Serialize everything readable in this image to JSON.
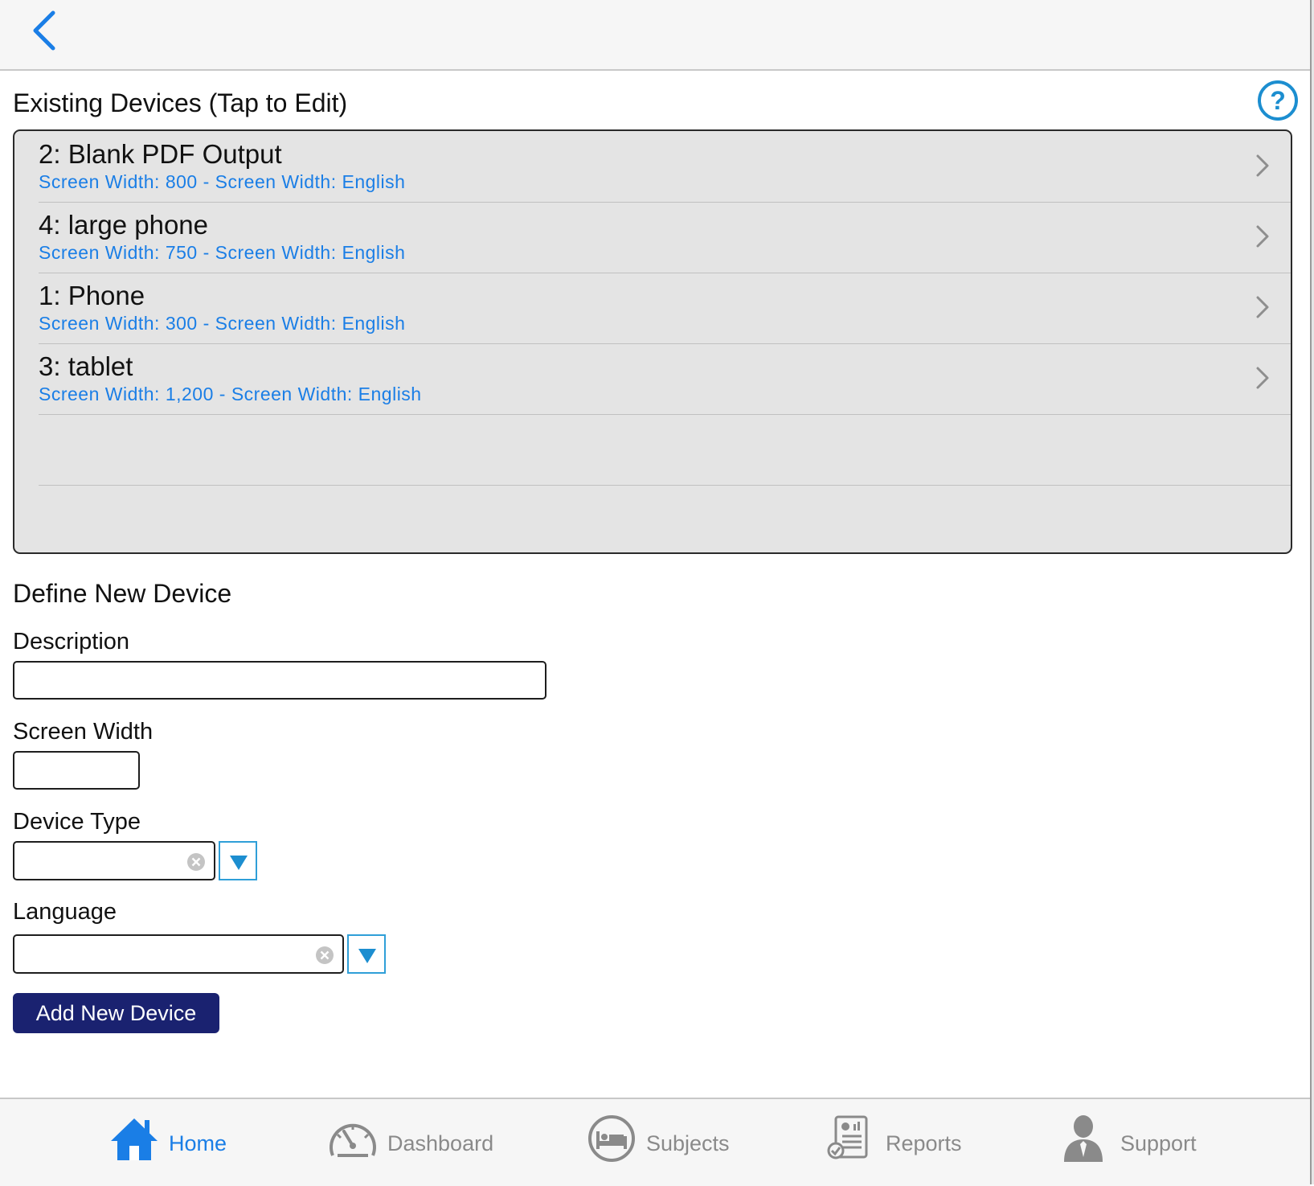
{
  "nav": {
    "back_icon": "chevron-left-icon",
    "accent_color": "#1a7ee6"
  },
  "existing": {
    "title": "Existing Devices (Tap to Edit)",
    "help_icon": "question-circle-icon",
    "devices": [
      {
        "name": "2: Blank PDF Output",
        "detail": "Screen Width: 800 - Screen Width: English"
      },
      {
        "name": "4: large phone",
        "detail": "Screen Width: 750 - Screen Width: English"
      },
      {
        "name": "1: Phone",
        "detail": "Screen Width: 300 - Screen Width: English"
      },
      {
        "name": "3: tablet",
        "detail": "Screen Width: 1,200 - Screen Width: English"
      }
    ]
  },
  "new_device": {
    "title": "Define New Device",
    "description": {
      "label": "Description",
      "value": ""
    },
    "screen_width": {
      "label": "Screen Width",
      "value": ""
    },
    "device_type": {
      "label": "Device Type",
      "value": ""
    },
    "language": {
      "label": "Language",
      "value": ""
    },
    "add_button": "Add New Device",
    "button_color": "#1a2270",
    "dropdown_color": "#2f9fd8"
  },
  "tabbar": {
    "tabs": [
      {
        "label": "Home",
        "icon": "home-icon",
        "active": true
      },
      {
        "label": "Dashboard",
        "icon": "speedometer-icon",
        "active": false
      },
      {
        "label": "Subjects",
        "icon": "bed-icon",
        "active": false
      },
      {
        "label": "Reports",
        "icon": "report-document-icon",
        "active": false
      },
      {
        "label": "Support",
        "icon": "person-icon",
        "active": false
      }
    ]
  }
}
